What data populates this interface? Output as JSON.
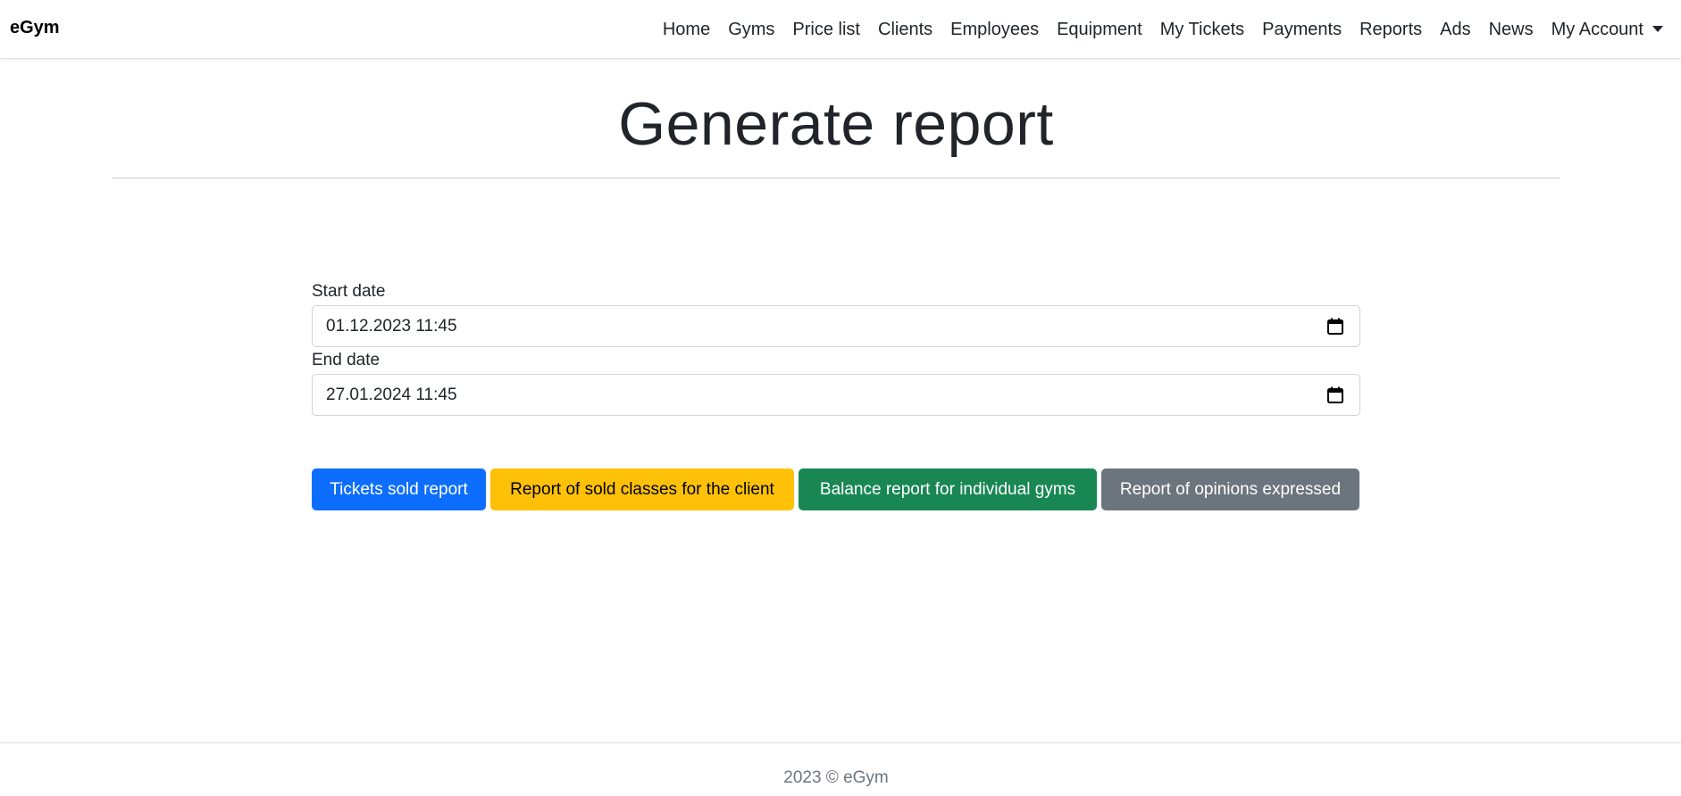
{
  "navbar": {
    "brand": "eGym",
    "items": [
      {
        "label": "Home"
      },
      {
        "label": "Gyms"
      },
      {
        "label": "Price list"
      },
      {
        "label": "Clients"
      },
      {
        "label": "Employees"
      },
      {
        "label": "Equipment"
      },
      {
        "label": "My Tickets"
      },
      {
        "label": "Payments"
      },
      {
        "label": "Reports"
      },
      {
        "label": "Ads"
      },
      {
        "label": "News"
      }
    ],
    "account_label": "My Account"
  },
  "main": {
    "title": "Generate report",
    "start_date": {
      "label": "Start date",
      "value": "01.12.2023 11:45"
    },
    "end_date": {
      "label": "End date",
      "value": "27.01.2024 11:45"
    },
    "buttons": {
      "tickets_sold": "Tickets sold report",
      "sold_classes": "Report of sold classes for the client",
      "balance": "Balance report for individual gyms",
      "opinions": "Report of opinions expressed"
    },
    "button_colors": {
      "primary": "#0d6efd",
      "warning": "#ffc107",
      "success": "#198754",
      "secondary": "#6c757d"
    }
  },
  "footer": {
    "text": "2023 © eGym"
  }
}
